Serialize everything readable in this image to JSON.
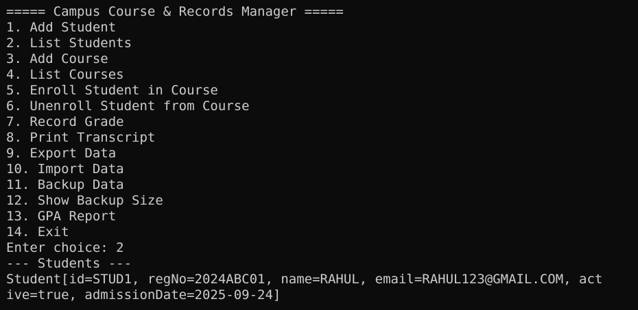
{
  "terminal": {
    "colors": {
      "background": "#0c0c0c",
      "foreground": "#cccccc"
    },
    "header": "===== Campus Course & Records Manager =====",
    "menu": [
      "1. Add Student",
      "2. List Students",
      "3. Add Course",
      "4. List Courses",
      "5. Enroll Student in Course",
      "6. Unenroll Student from Course",
      "7. Record Grade",
      "8. Print Transcript",
      "9. Export Data",
      "10. Import Data",
      "11. Backup Data",
      "12. Show Backup Size",
      "13. GPA Report",
      "14. Exit"
    ],
    "prompt": "Enter choice: 2",
    "section_header": "--- Students ---",
    "output": [
      "Student[id=STUD1, regNo=2024ABC01, name=RAHUL, email=RAHUL123@GMAIL.COM, act",
      "ive=true, admissionDate=2025-09-24]"
    ]
  }
}
